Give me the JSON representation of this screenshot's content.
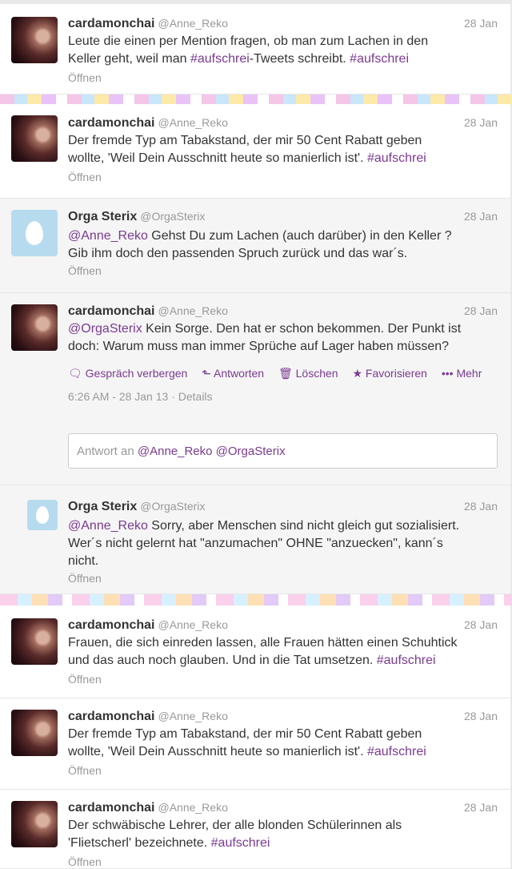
{
  "tweets": [
    {
      "name": "cardamonchai",
      "handle": "@Anne_Reko",
      "date": "28 Jan",
      "lines": [
        [
          "Leute die einen per Mention fragen, ob man zum Lachen in den"
        ],
        [
          "Keller geht, weil man ",
          "#aufschrei",
          "-Tweets schreibt. ",
          "#aufschrei"
        ]
      ],
      "open": "Öffnen"
    },
    {
      "name": "cardamonchai",
      "handle": "@Anne_Reko",
      "date": "28 Jan",
      "line1": "Der fremde Typ am Tabakstand, der mir 50 Cent Rabatt geben",
      "line2": "wollte, 'Weil Dein Ausschnitt heute so manierlich ist'. ",
      "hash": "#aufschrei",
      "open": "Öffnen"
    },
    {
      "name": "Orga Sterix",
      "handle": "@OrgaSterix",
      "date": "28 Jan",
      "mention": "@Anne_Reko",
      "line1": " Gehst Du zum Lachen (auch darüber) in den Keller ?",
      "line2": "Gib ihm doch den passenden Spruch zurück und das war´s.",
      "open": "Öffnen"
    },
    {
      "name": "cardamonchai",
      "handle": "@Anne_Reko",
      "date": "28 Jan",
      "mention": "@OrgaSterix",
      "line1": " Kein Sorge. Den hat er schon bekommen. Der Punkt ist",
      "line2": "doch: Warum muss man immer Sprüche auf Lager haben müssen?",
      "actions": {
        "hide": "Gespräch verbergen",
        "reply": "Antworten",
        "delete": "Löschen",
        "fav": "Favorisieren",
        "more": "Mehr"
      },
      "meta": "6:26 AM - 28 Jan 13 · Details"
    },
    {
      "name": "Orga Sterix",
      "handle": "@OrgaSterix",
      "date": "28 Jan",
      "mention": "@Anne_Reko",
      "line1": " Sorry, aber Menschen sind nicht gleich gut sozialisiert.",
      "line2": "Wer´s nicht gelernt hat \"anzumachen\" OHNE \"anzuecken\", kann´s",
      "line3": "nicht.",
      "open": "Öffnen"
    },
    {
      "name": "cardamonchai",
      "handle": "@Anne_Reko",
      "date": "28 Jan",
      "line1": "Frauen, die sich einreden lassen, alle Frauen hätten einen Schuhtick",
      "line2": "und das auch noch glauben. Und in die Tat umsetzen. ",
      "hash": "#aufschrei",
      "open": "Öffnen"
    },
    {
      "name": "cardamonchai",
      "handle": "@Anne_Reko",
      "date": "28 Jan",
      "line1": "Der fremde Typ am Tabakstand, der mir 50 Cent Rabatt geben",
      "line2": "wollte, 'Weil Dein Ausschnitt heute so manierlich ist'. ",
      "hash": "#aufschrei",
      "open": "Öffnen"
    },
    {
      "name": "cardamonchai",
      "handle": "@Anne_Reko",
      "date": "28 Jan",
      "line1": "Der schwäbische Lehrer, der alle blonden Schülerinnen als",
      "line2": "'Flietscherl' bezeichnete. ",
      "hash": "#aufschrei",
      "open": "Öffnen"
    }
  ],
  "reply": {
    "prefix": "Antwort an ",
    "mentions": "@Anne_Reko @OrgaSterix"
  }
}
